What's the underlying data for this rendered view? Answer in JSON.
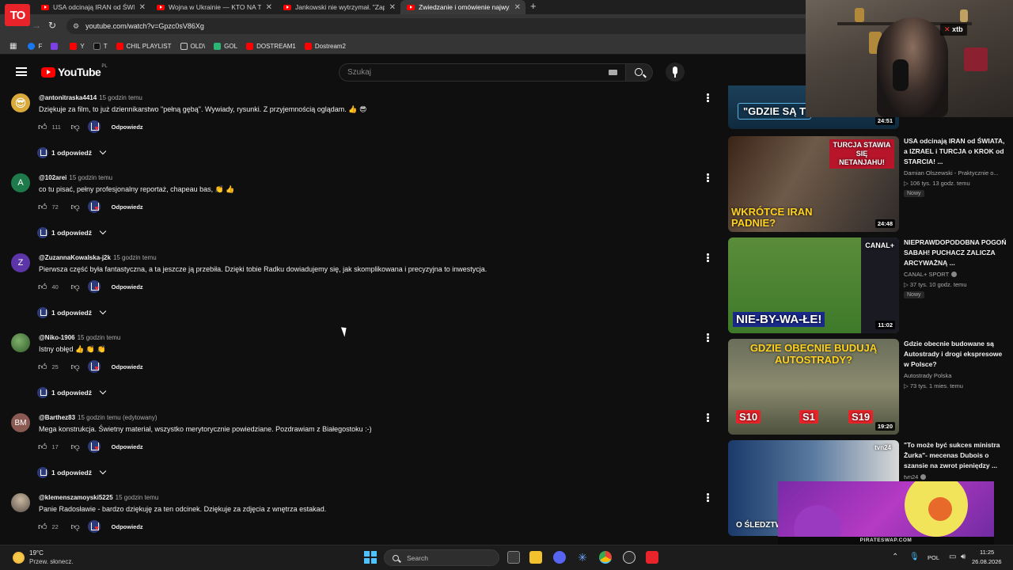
{
  "browser": {
    "tv_logo": "TO",
    "tabs": [
      {
        "title": "USA odcinają IRAN od ŚWIATA"
      },
      {
        "title": "Wojna w Ukrainie — KTO NA T"
      },
      {
        "title": "Jankowski nie wytrzymał. \"Zap"
      },
      {
        "title": "Zwiedzanie i omówienie najwyż"
      }
    ],
    "new_tab": "+",
    "url": "youtube.com/watch?v=Gpzc0sV86Xg",
    "bookmarks": [
      {
        "label": "F",
        "color": "#1877f2"
      },
      {
        "label": "",
        "color": "#7b3fe4"
      },
      {
        "label": "Y",
        "color": "#ff0000"
      },
      {
        "label": "T",
        "color": "#1f1f1f"
      },
      {
        "label": "CHIL PLAYLIST",
        "color": "#ff0000"
      },
      {
        "label": "OLD\\",
        "color": "#353535"
      },
      {
        "label": "GOL",
        "color": "#2bb673"
      },
      {
        "label": "DOSTREAM1",
        "color": "#ff0000"
      },
      {
        "label": "Dostream2",
        "color": "#ff0000"
      }
    ]
  },
  "youtube": {
    "logo_text": "YouTube",
    "region": "PL",
    "search_placeholder": "Szukaj"
  },
  "comments": [
    {
      "author": "@antonitraska4414",
      "time": "15 godzin temu",
      "text": "Dziękuje za film, to już dziennikarstwo \"pełną gębą\". Wywiady, rysunki. Z przyjemnością oglądam. 👍 😎",
      "likes": "111",
      "reply_label": "Odpowiedz",
      "replies": "1 odpowiedź",
      "avatar_text": "😎",
      "avatar_color": "#d9a93a"
    },
    {
      "author": "@102arei",
      "time": "15 godzin temu",
      "text": "co tu pisać, pełny profesjonalny reportaż, chapeau bas, 👏 👍",
      "likes": "72",
      "reply_label": "Odpowiedz",
      "replies": "1 odpowiedź",
      "avatar_text": "A",
      "avatar_color": "#1e7a4a"
    },
    {
      "author": "@ZuzannaKowalska-j2k",
      "time": "15 godzin temu",
      "text": "Pierwsza część była fantastyczna, a ta jeszcze ją przebiła. Dzięki tobie Radku dowiadujemy się, jak skomplikowana i precyzyjna to inwestycja.",
      "likes": "40",
      "reply_label": "Odpowiedz",
      "replies": "1 odpowiedź",
      "avatar_text": "Z",
      "avatar_color": "#5c35a8"
    },
    {
      "author": "@Niko-1906",
      "time": "15 godzin temu",
      "text": "Istny obłęd 👍 👏 👏",
      "likes": "25",
      "reply_label": "Odpowiedz",
      "replies": "1 odpowiedź",
      "avatar_text": "",
      "avatar_color": "#4a7a3a"
    },
    {
      "author": "@Barthez83",
      "time": "15 godzin temu (edytowany)",
      "text": "Mega konstrukcja. Świetny materiał, wszystko merytorycznie powiedziane. Pozdrawiam z Białegostoku :-)",
      "likes": "17",
      "reply_label": "Odpowiedz",
      "replies": "1 odpowiedź",
      "avatar_text": "BM",
      "avatar_color": "#8a5a52"
    },
    {
      "author": "@klemenszamoyski5225",
      "time": "15 godzin temu",
      "text": "Panie Radosławie - bardzo dziękuję za ten odcinek. Dziękuje za zdjęcia z wnętrza estakad.",
      "likes": "22",
      "reply_label": "Odpowiedz",
      "replies": "",
      "avatar_text": "",
      "avatar_color": "#6a6a6a"
    }
  ],
  "recommended": [
    {
      "title": "",
      "channel": "",
      "meta": "",
      "badge": "",
      "duration": "24:51",
      "thumb_text": "\"GDZIE SĄ T"
    },
    {
      "title": "USA odcinają IRAN od ŚWIATA, a IZRAEL i TURCJA o KROK od STARCIA! ...",
      "channel": "Damian Olszewski - Praktycznie o...",
      "meta": "▷ 106 tys.   13 godz. temu",
      "badge": "Nowy",
      "duration": "24:48",
      "thumb_text": "WKRÓTCE IRAN PADNIE?",
      "thumb_text2": "TURCJA STAWIA SIĘ NETANJAHU!"
    },
    {
      "title": "NIEPRAWDOPODOBNA POGOŃ SABAH! PUCHACZ ZALICZA ARCYWAŻNĄ ...",
      "channel": "CANAL+ SPORT",
      "meta": "▷ 37 tys.   10 godz. temu",
      "badge": "Nowy",
      "duration": "11:02",
      "thumb_text": "NIE-BY-WA-ŁE!",
      "thumb_text2": "CANAL+"
    },
    {
      "title": "Gdzie obecnie budowane są Autostrady i drogi ekspresowe w Polsce?",
      "channel": "Autostrady Polska",
      "meta": "▷ 73 tys.   1 mies. temu",
      "badge": "",
      "duration": "19:20",
      "thumb_text": "GDZIE OBECNIE BUDUJĄ AUTOSTRADY?",
      "tags": [
        "S10",
        "S1",
        "S19"
      ]
    },
    {
      "title": "\"To może być sukces ministra Żurka\"- mecenas Dubois o szansie na zwrot pieniędzy ...",
      "channel": "tvn24",
      "meta": "",
      "badge": "",
      "duration": "",
      "thumb_text": "O ŚLEDZTW",
      "thumb_text2": "tvn24"
    }
  ],
  "overlay": {
    "webcam_brand": "xtb",
    "ad_footer": "PIRATESWAP.COM"
  },
  "taskbar": {
    "temp": "19°C",
    "weather": "Przew. słonecz.",
    "search_label": "Search",
    "lang": "POL",
    "time": "11:25",
    "date": "26.08.2026"
  }
}
